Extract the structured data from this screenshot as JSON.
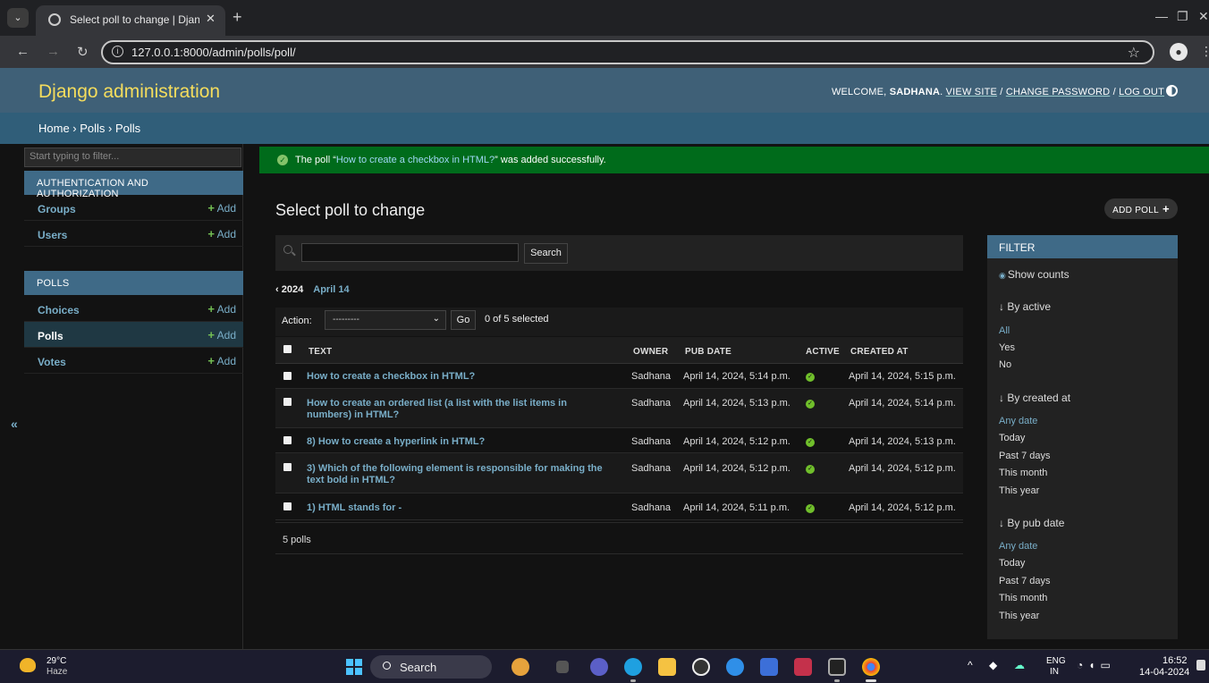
{
  "browser": {
    "tab_title": "Select poll to change | Django site admin",
    "tab_close": "✕",
    "new_tab": "+",
    "url": "127.0.0.1:8000/admin/polls/poll/"
  },
  "header": {
    "branding": "Django administration",
    "welcome": "WELCOME,",
    "username": "SADHANA",
    "view_site": "VIEW SITE",
    "change_password": "CHANGE PASSWORD",
    "log_out": "LOG OUT",
    "sep": " / "
  },
  "breadcrumbs": "Home › Polls › Polls",
  "sidebar": {
    "filter_placeholder": "Start typing to filter...",
    "auth_caption": "AUTHENTICATION AND AUTHORIZATION",
    "polls_caption": "POLLS",
    "add_label": "Add",
    "auth_models": [
      "Groups",
      "Users"
    ],
    "polls_models": [
      "Choices",
      "Polls",
      "Votes"
    ],
    "collapse": "«"
  },
  "message": {
    "prefix": "The poll “",
    "link": "How to create a checkbox in HTML?",
    "suffix": "” was added successfully."
  },
  "content": {
    "title": "Select poll to change",
    "add_button": "ADD POLL",
    "search_button": "Search",
    "date_back": "‹ 2024",
    "date_current": "April 14",
    "action_label": "Action:",
    "action_select": "---------",
    "go_button": "Go",
    "counter": "0 of 5 selected",
    "paginator": "5 polls"
  },
  "table": {
    "headers": {
      "text": "TEXT",
      "owner": "OWNER",
      "pub_date": "PUB DATE",
      "active": "ACTIVE",
      "created_at": "CREATED AT"
    },
    "rows": [
      {
        "text": "How to create a checkbox in HTML?",
        "owner": "Sadhana",
        "pub_date": "April 14, 2024, 5:14 p.m.",
        "created_at": "April 14, 2024, 5:15 p.m."
      },
      {
        "text": "How to create an ordered list (a list with the list items in numbers) in HTML?",
        "owner": "Sadhana",
        "pub_date": "April 14, 2024, 5:13 p.m.",
        "created_at": "April 14, 2024, 5:14 p.m."
      },
      {
        "text": "8) How to create a hyperlink in HTML?",
        "owner": "Sadhana",
        "pub_date": "April 14, 2024, 5:12 p.m.",
        "created_at": "April 14, 2024, 5:13 p.m."
      },
      {
        "text": "3) Which of the following element is responsible for making the text bold in HTML?",
        "owner": "Sadhana",
        "pub_date": "April 14, 2024, 5:12 p.m.",
        "created_at": "April 14, 2024, 5:12 p.m."
      },
      {
        "text": "1) HTML stands for -",
        "owner": "Sadhana",
        "pub_date": "April 14, 2024, 5:11 p.m.",
        "created_at": "April 14, 2024, 5:12 p.m."
      }
    ]
  },
  "filter": {
    "caption": "FILTER",
    "show_counts": "Show counts",
    "by_active": "↓ By active",
    "active_options": [
      "All",
      "Yes",
      "No"
    ],
    "by_created": "↓ By created at",
    "by_pub": "↓ By pub date",
    "date_options": [
      "Any date",
      "Today",
      "Past 7 days",
      "This month",
      "This year"
    ]
  },
  "taskbar": {
    "temp": "29°C",
    "weather": "Haze",
    "search": "Search",
    "lang1": "ENG",
    "lang2": "IN",
    "time": "16:52",
    "date": "14-04-2024"
  },
  "colors": {
    "accent": "#79aec8",
    "header": "#3f6077",
    "success": "#006b1b",
    "branding": "#f5dd5d"
  }
}
